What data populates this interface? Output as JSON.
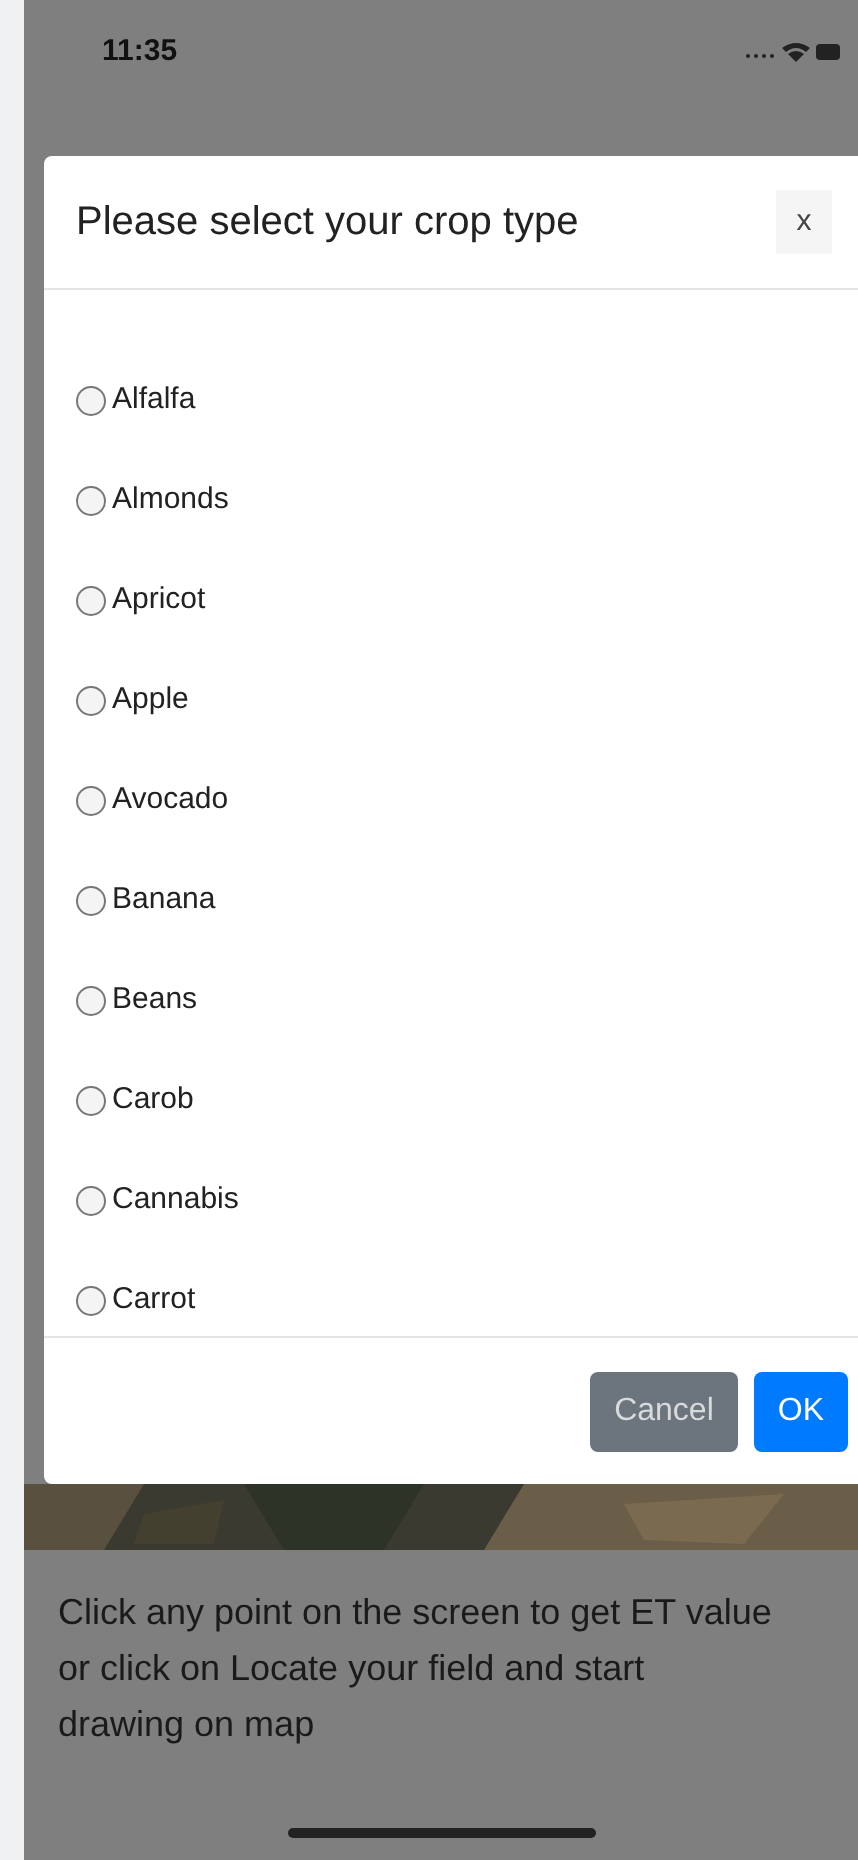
{
  "status_bar": {
    "time": "11:35"
  },
  "dialog": {
    "title": "Please select your crop type",
    "close": "x",
    "options": [
      {
        "label": "Alfalfa",
        "selected": false
      },
      {
        "label": "Almonds",
        "selected": false
      },
      {
        "label": "Apricot",
        "selected": false
      },
      {
        "label": "Apple",
        "selected": false
      },
      {
        "label": "Avocado",
        "selected": false
      },
      {
        "label": "Banana",
        "selected": false
      },
      {
        "label": "Beans",
        "selected": false
      },
      {
        "label": "Carob",
        "selected": false
      },
      {
        "label": "Cannabis",
        "selected": false
      },
      {
        "label": "Carrot",
        "selected": false
      }
    ],
    "buttons": [
      {
        "label": "Cancel",
        "kind": "secondary"
      },
      {
        "label": "OK",
        "kind": "primary"
      }
    ]
  },
  "instructions": "Click any point on the screen to get ET value or click on Locate your field and start drawing on map"
}
